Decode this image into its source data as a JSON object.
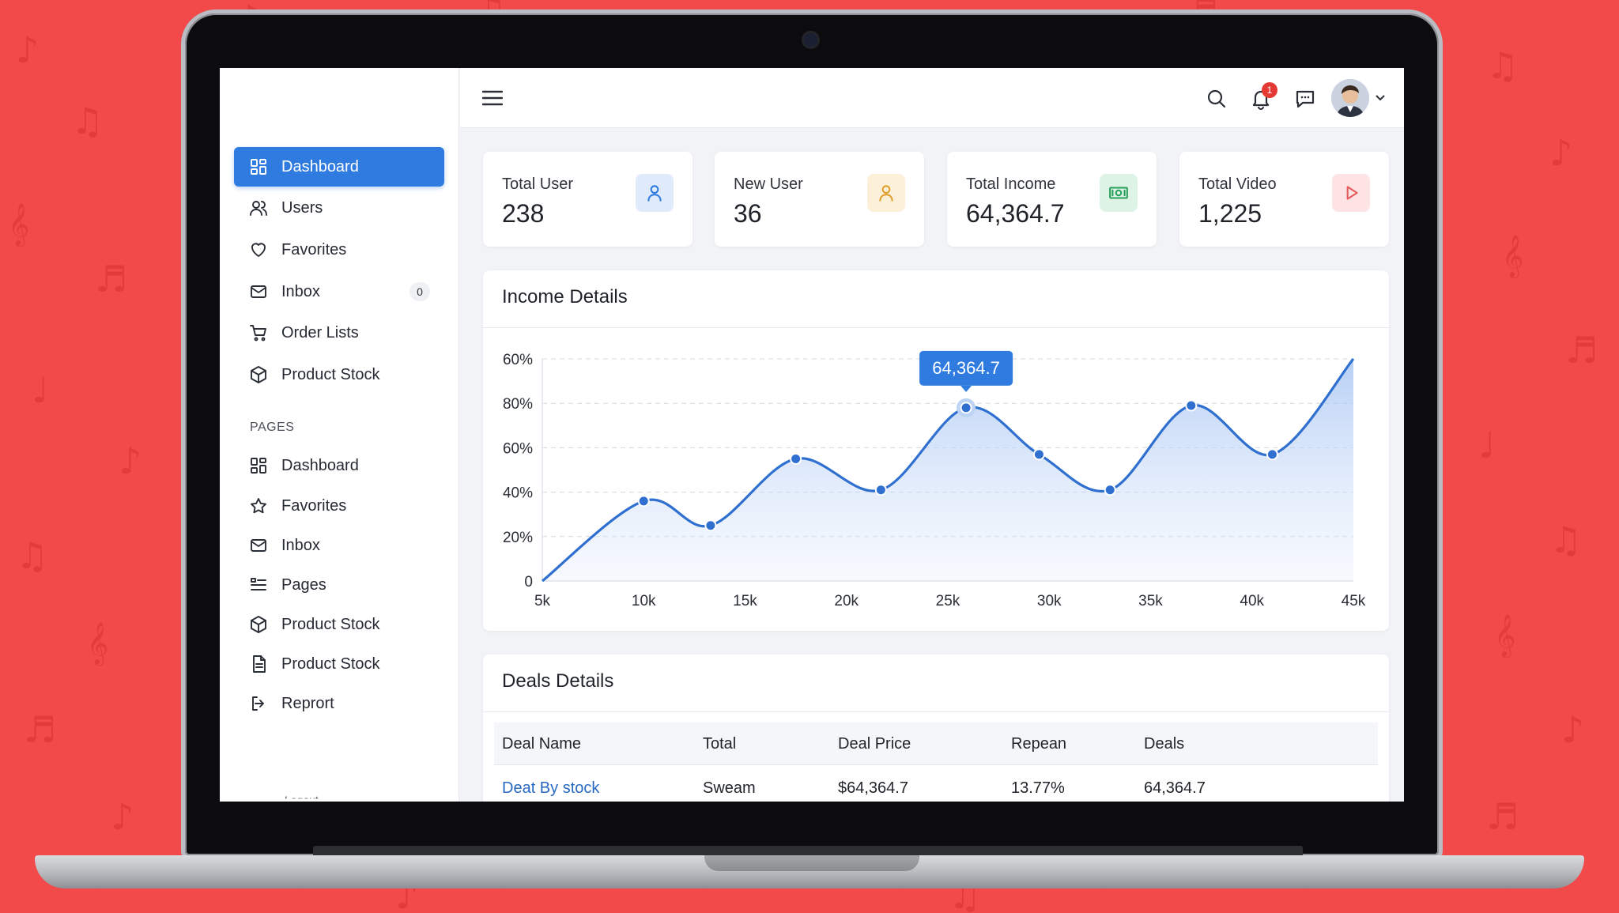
{
  "sidebar": {
    "main_items": [
      {
        "label": "Dashboard",
        "icon": "grid-icon",
        "active": true
      },
      {
        "label": "Users",
        "icon": "users-icon"
      },
      {
        "label": "Favorites",
        "icon": "heart-icon"
      },
      {
        "label": "Inbox",
        "icon": "mail-icon",
        "badge": "0"
      },
      {
        "label": "Order Lists",
        "icon": "cart-icon"
      },
      {
        "label": "Product Stock",
        "icon": "box-icon"
      }
    ],
    "section_label": "PAGES",
    "page_items": [
      {
        "label": "Dashboard",
        "icon": "grid-icon"
      },
      {
        "label": "Favorites",
        "icon": "star-icon"
      },
      {
        "label": "Inbox",
        "icon": "mail-icon"
      },
      {
        "label": "Pages",
        "icon": "list-icon"
      },
      {
        "label": "Product Stock",
        "icon": "box-icon"
      },
      {
        "label": "Product Stock",
        "icon": "document-icon"
      },
      {
        "label": "Reprort",
        "icon": "logout-icon"
      }
    ],
    "cut_off_label": "Logout"
  },
  "topbar": {
    "notification_count": "1"
  },
  "stats": [
    {
      "label": "Total User",
      "value": "238",
      "icon": "user-icon",
      "color": "#2f7be0",
      "bg": "#dfeafb"
    },
    {
      "label": "New User",
      "value": "36",
      "icon": "user-icon",
      "color": "#e0a030",
      "bg": "#fdf0d8"
    },
    {
      "label": "Total Income",
      "value": "64,364.7",
      "icon": "money-icon",
      "color": "#27a05a",
      "bg": "#dcf3e5"
    },
    {
      "label": "Total Video",
      "value": "1,225",
      "icon": "play-icon",
      "color": "#e55a5a",
      "bg": "#fde3e3"
    }
  ],
  "income_panel": {
    "title": "Income Details",
    "tooltip": "64,364.7"
  },
  "chart_data": {
    "type": "area",
    "x": [
      5000,
      10000,
      13300,
      17500,
      21700,
      25900,
      29500,
      33000,
      37000,
      41000,
      45000
    ],
    "values": [
      0,
      36,
      25,
      55,
      41,
      78,
      57,
      41,
      79,
      57,
      100
    ],
    "xticks": [
      "5k",
      "10k",
      "15k",
      "20k",
      "25k",
      "30k",
      "35k",
      "40k",
      "45k"
    ],
    "yticks": [
      "0",
      "20%",
      "40%",
      "60%",
      "80%",
      "60%"
    ],
    "xlim": [
      5000,
      45000
    ],
    "ylim": [
      0,
      100
    ],
    "grid": true,
    "line_color": "#2f6fd0"
  },
  "deals_panel": {
    "title": "Deals Details",
    "columns": [
      "Deal Name",
      "Total",
      "Deal Price",
      "Repean",
      "Deals"
    ],
    "rows": [
      [
        "Deat By stock",
        "Sweam",
        "$64,364.7",
        "13.77%",
        "64,364.7"
      ]
    ]
  }
}
